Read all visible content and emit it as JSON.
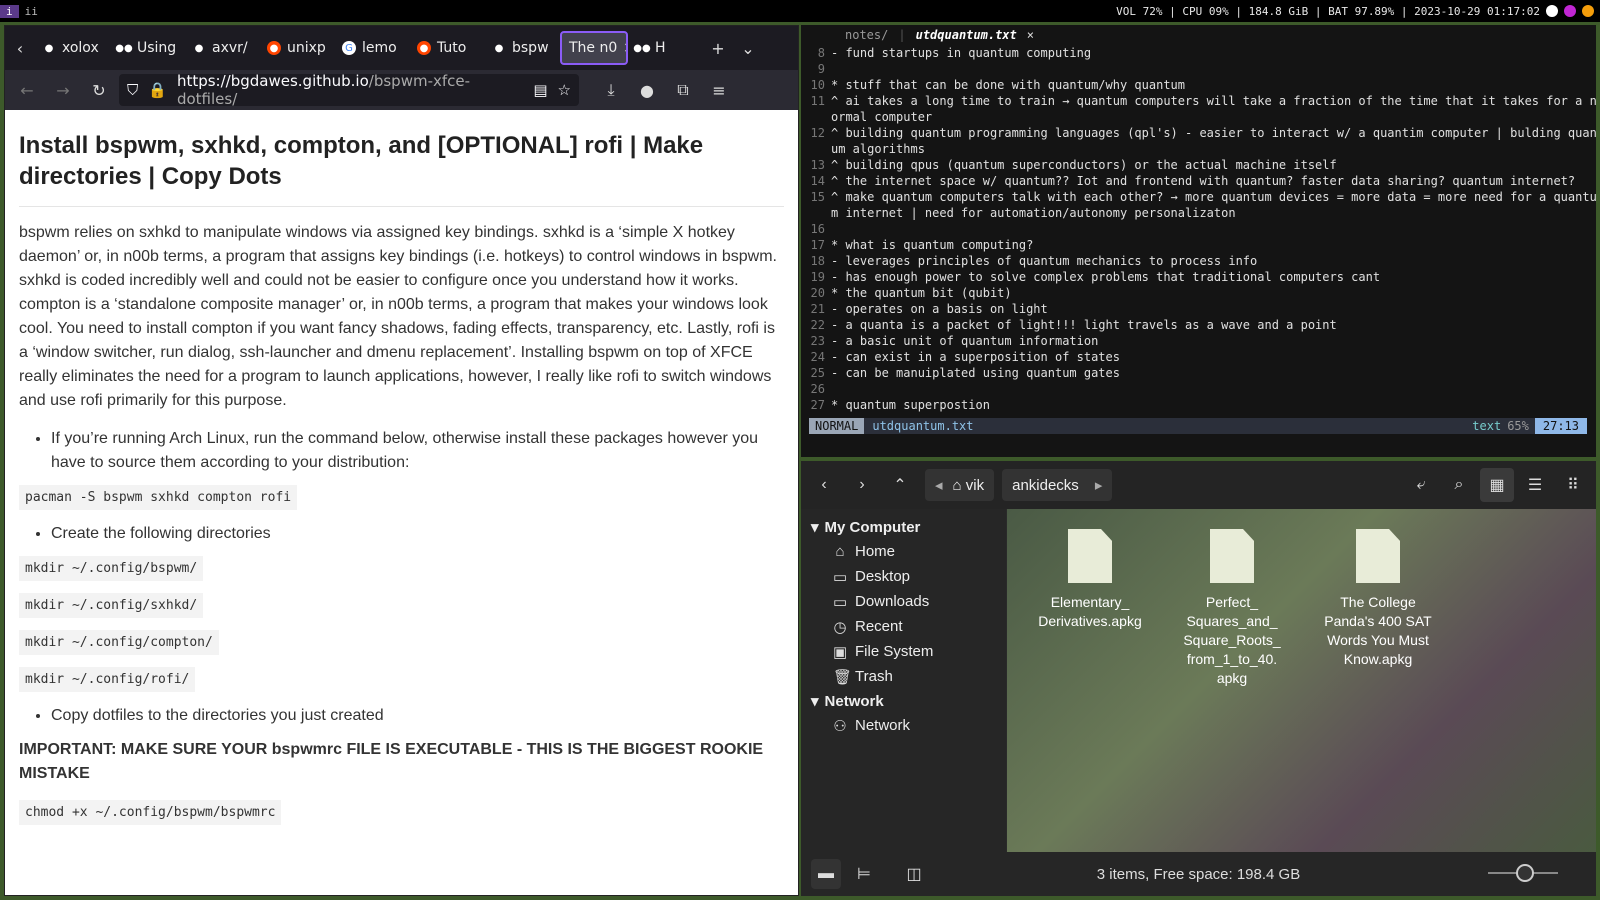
{
  "topbar": {
    "workspaces": [
      "i",
      "ii"
    ],
    "status": "VOL 72% | CPU 09% | 184.8 GiB | BAT 97.89% | 2023-10-29 01:17:02"
  },
  "browser": {
    "tabs": [
      {
        "label": "xolox",
        "icon": "github-icon"
      },
      {
        "label": "Using",
        "icon": "medium-icon"
      },
      {
        "label": "axvr/",
        "icon": "github-icon"
      },
      {
        "label": "unixp",
        "icon": "reddit-icon"
      },
      {
        "label": "lemo",
        "icon": "google-icon"
      },
      {
        "label": "Tuto",
        "icon": "reddit-icon"
      },
      {
        "label": "bspw",
        "icon": "github-icon"
      },
      {
        "label": "The n0",
        "icon": "none",
        "active": true
      },
      {
        "label": "H",
        "icon": "medium-icon"
      }
    ],
    "url_host": "https://bgdawes.github.io",
    "url_path": "/bspwm-xfce-dotfiles/",
    "page": {
      "title": "Install bspwm, sxhkd, compton, and [OPTIONAL] rofi | Make directories | Copy Dots",
      "intro": "bspwm relies on sxhkd to manipulate windows via assigned key bindings. sxhkd is a ‘simple X hotkey daemon’ or, in n00b terms, a program that assigns key bindings (i.e. hotkeys) to control windows in bspwm. sxhkd is coded incredibly well and could not be easier to configure once you understand how it works. compton is a ‘standalone composite manager’ or, in n00b terms, a program that makes your windows look cool. You need to install compton if you want fancy shadows, fading effects, transparency, etc. Lastly, rofi is a ‘window switcher, run dialog, ssh-launcher and dmenu replacement’. Installing bspwm on top of XFCE really eliminates the need for a program to launch applications, however, I really like rofi to switch windows and use rofi primarily for this purpose.",
      "bullet1": "If you’re running Arch Linux, run the command below, otherwise install these packages however you have to source them according to your distribution:",
      "code1": "pacman -S bspwm sxhkd compton rofi",
      "bullet2": "Create the following directories",
      "code2": "mkdir ~/.config/bspwm/",
      "code3": "mkdir ~/.config/sxhkd/",
      "code4": "mkdir ~/.config/compton/",
      "code5": "mkdir ~/.config/rofi/",
      "bullet3": "Copy dotfiles to the directories you just created",
      "important": "IMPORTANT: MAKE SURE YOUR bspwmrc FILE IS EXECUTABLE - THIS IS THE BIGGEST ROOKIE MISTAKE",
      "code6": "chmod +x ~/.config/bspwm/bspwmrc"
    }
  },
  "vim": {
    "tab1": "notes/",
    "tab2": "utdquantum.txt",
    "lines": [
      {
        "n": "8",
        "t": "- fund startups in quantum computing"
      },
      {
        "n": "9",
        "t": ""
      },
      {
        "n": "10",
        "t": "* stuff that can be done with quantum/why quantum"
      },
      {
        "n": "11",
        "t": "^ ai takes a long time to train → quantum computers will take a fraction of the time that it takes for a n"
      },
      {
        "n": "",
        "t": "ormal computer"
      },
      {
        "n": "12",
        "t": "^ building quantum programming languages (qpl's) - easier to interact w/ a quantim computer | bulding quant"
      },
      {
        "n": "",
        "t": "um algorithms"
      },
      {
        "n": "13",
        "t": "^ building qpus (quantum superconductors) or the actual machine itself"
      },
      {
        "n": "14",
        "t": "^ the internet space w/ quantum?? Iot and frontend with quantum? faster data sharing? quantum internet?"
      },
      {
        "n": "15",
        "t": "^ make quantum computers talk with each other? → more quantum devices = more data = more need for a quantu"
      },
      {
        "n": "",
        "t": "m internet | need for automation/autonomy personalizaton"
      },
      {
        "n": "16",
        "t": ""
      },
      {
        "n": "17",
        "t": "* what is quantum computing?"
      },
      {
        "n": "18",
        "t": "- leverages principles of quantum mechanics to process info"
      },
      {
        "n": "19",
        "t": "- has enough power to solve complex problems that traditional computers cant"
      },
      {
        "n": "20",
        "t": "* the quantum bit (qubit)"
      },
      {
        "n": "21",
        "t": "- operates on a basis on light"
      },
      {
        "n": "22",
        "t": "- a quanta is a packet of light!!! light travels as a wave and a point"
      },
      {
        "n": "23",
        "t": "- a basic unit of quantum information"
      },
      {
        "n": "24",
        "t": "- can exist in a superposition of states"
      },
      {
        "n": "25",
        "t": "- can be manuiplated using quantum gates"
      },
      {
        "n": "26",
        "t": ""
      },
      {
        "n": "27",
        "t": "* quantum superpostion"
      }
    ],
    "mode": "NORMAL",
    "filename": "utdquantum.txt",
    "filetype": "text",
    "percent": "65%",
    "position": "27:13"
  },
  "filemanager": {
    "crumb_home": "vik",
    "crumb_current": "ankidecks",
    "sections": [
      {
        "title": "My Computer",
        "items": [
          {
            "label": "Home",
            "icon": "home-icon",
            "glyph": "⌂"
          },
          {
            "label": "Desktop",
            "icon": "folder-icon",
            "glyph": "▭"
          },
          {
            "label": "Downloads",
            "icon": "folder-icon",
            "glyph": "▭"
          },
          {
            "label": "Recent",
            "icon": "clock-icon",
            "glyph": "◷"
          },
          {
            "label": "File System",
            "icon": "drive-icon",
            "glyph": "▣"
          },
          {
            "label": "Trash",
            "icon": "trash-icon",
            "glyph": "🗑"
          }
        ]
      },
      {
        "title": "Network",
        "items": [
          {
            "label": "Network",
            "icon": "network-icon",
            "glyph": "⚇"
          }
        ]
      }
    ],
    "files": [
      {
        "name": "Elementary_\nDerivatives.apkg"
      },
      {
        "name": "Perfect_\nSquares_and_\nSquare_Roots_\nfrom_1_to_40.\napkg"
      },
      {
        "name": "The College\nPanda's 400 SAT\nWords You Must\nKnow.apkg"
      }
    ],
    "status": "3 items, Free space: 198.4 GB"
  }
}
